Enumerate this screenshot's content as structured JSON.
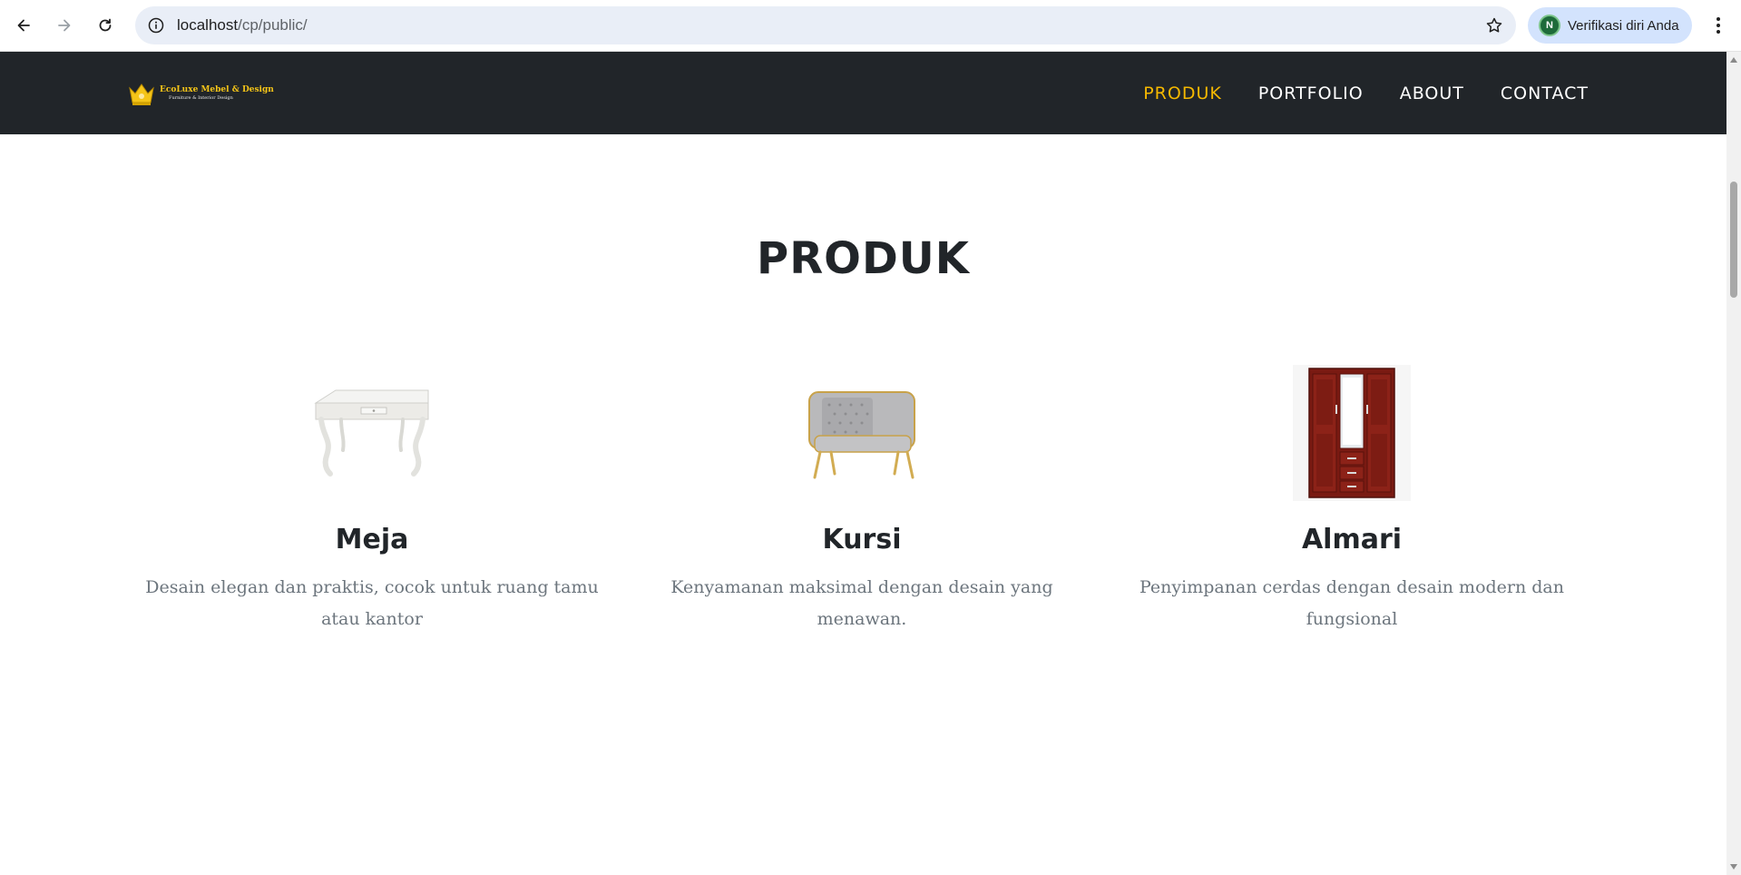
{
  "browser": {
    "url_host": "localhost",
    "url_path": "/cp/public/",
    "profile_initial": "N",
    "profile_label": "Verifikasi diri Anda"
  },
  "site": {
    "brand_name": "EcoLuxe Mebel & Design",
    "brand_tagline": "Furniture & Interior Design",
    "nav": [
      {
        "label": "PRODUK",
        "active": true
      },
      {
        "label": "PORTFOLIO",
        "active": false
      },
      {
        "label": "ABOUT",
        "active": false
      },
      {
        "label": "CONTACT",
        "active": false
      }
    ],
    "accent_color": "#f5b800",
    "nav_bg": "#212529"
  },
  "section": {
    "title": "PRODUK"
  },
  "products": [
    {
      "name": "Meja",
      "desc": "Desain elegan dan praktis, cocok untuk ruang tamu atau kantor",
      "icon": "table-image"
    },
    {
      "name": "Kursi",
      "desc": "Kenyamanan maksimal dengan desain yang menawan.",
      "icon": "armchair-image"
    },
    {
      "name": "Almari",
      "desc": "Penyimpanan cerdas dengan desain modern dan fungsional",
      "icon": "wardrobe-image"
    }
  ]
}
